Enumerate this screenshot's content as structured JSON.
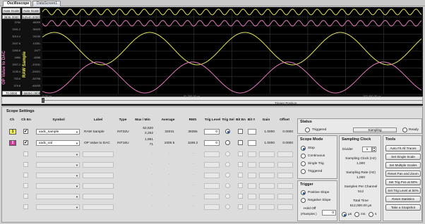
{
  "tabs": [
    {
      "label": "Oscilloscope"
    },
    {
      "label": "DataScreen1"
    }
  ],
  "scope": {
    "auto_scale_left": "Auto Scale",
    "auto_scale_right": "Auto Scale",
    "top_left_value": "3836.0000",
    "top_right_value": "62540.0000",
    "bottom_left_value": "70.0000",
    "bottom_right_value": "-58050.0000",
    "left_ticks": [
      "3760",
      "3391.2",
      "3014.4",
      "2637.6",
      "2260.8",
      "1884",
      "1507.2",
      "1130.4",
      "753.6",
      "376.8"
    ],
    "right_ticks": [
      "46059",
      "35929",
      "24150",
      "13351",
      "2477",
      "-8286",
      "-19151",
      "-20021",
      "-30796",
      "-48259"
    ],
    "left_axis_label": "OP Value to DAC",
    "right_axis_label": "RAW Sample",
    "x_labels": [
      "0.00",
      "51,200.00",
      "102,400.00"
    ],
    "x_unit": "µs",
    "trigger_position_label": "Trigger Position",
    "colors": {
      "ch1": "#e6e65a",
      "ch2": "#e87ac0",
      "grid": "#3a3a3a"
    }
  },
  "settings": {
    "title": "Scope Settings",
    "headers": [
      "Ch",
      "Ch En",
      "Symbol",
      "Label",
      "Type",
      "Max / Min",
      "Average",
      "RMS",
      "Trig Level",
      "Trig Sel",
      "Bit En",
      "Bit #",
      "Gain",
      "Offset"
    ],
    "channels": [
      {
        "num": "1",
        "enabled": "✔",
        "symbol": "xadc_sample",
        "label": "RAW Sample",
        "type": "INT32U",
        "max": "62,520",
        "min": "2,252",
        "average": "32031",
        "rms": "38355",
        "trig_level": "0",
        "gain": "1.0000",
        "offset": "0.0000",
        "color": "#f2f25a"
      },
      {
        "num": "2",
        "enabled": "✔",
        "symbol": "xadc_val",
        "label": "OP Value to DAC",
        "type": "INT16U",
        "max": "1,951",
        "min": "71",
        "average": "1000.5",
        "rms": "1198.2",
        "trig_level": "0",
        "gain": "1.0000",
        "offset": "0.0000",
        "color": "#cc3a9c"
      }
    ],
    "empty_rows": [
      {
        "dash": "-"
      },
      {
        "dash": "-"
      },
      {
        "dash": "-"
      },
      {
        "dash": "-"
      },
      {
        "dash": "-"
      },
      {
        "dash": "-"
      }
    ]
  },
  "status": {
    "title": "Status",
    "triggered": "Triggered",
    "sampling": "Sampling",
    "ready": "Ready"
  },
  "scope_mode": {
    "title": "Scope Mode",
    "options": [
      "Stop",
      "Continuous",
      "Single Trig",
      "Triggered"
    ],
    "selected": "Stop"
  },
  "trigger": {
    "title": "Trigger",
    "options": [
      "Positive Slope",
      "Negative Slope"
    ],
    "selected": "Positive Slope",
    "hold_off_label": "Hold Off",
    "hold_off_sub": "(#Samples )",
    "hold_off_value": "0"
  },
  "sampling_clock": {
    "title": "Sampling Clock",
    "divider_label": "Divider",
    "divider_value": "1",
    "clock_label": "Sampling Clock (Hz)",
    "clock_value": "1,000",
    "rate_label": "Sampling Rate (Hz)",
    "rate_value": "1,000",
    "spc_label": "Samples Per Channel",
    "spc_value": "512",
    "total_label": "Total Time",
    "total_value": "512,000.00 µs",
    "units": [
      "µs",
      "ms",
      "s"
    ],
    "unit_selected": "µs"
  },
  "tools": {
    "title": "Tools",
    "buttons": [
      "Auto Fit All Traces",
      "Set Single Scale",
      "Set Multiple Scales",
      "Reset Pan and Zoom",
      "Set Trig Pos at 50%",
      "Set Trig Level at 50%",
      "Reset Statistics",
      "Take a Snapshot"
    ]
  }
}
